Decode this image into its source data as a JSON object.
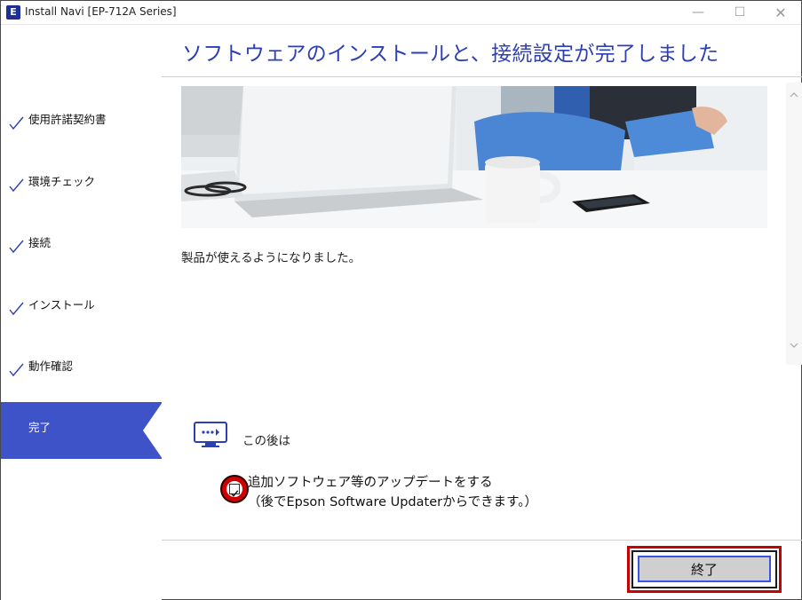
{
  "window": {
    "title": "Install Navi [EP-712A Series]",
    "app_icon": "E",
    "controls": {
      "minimize": "—",
      "maximize": "☐",
      "close": "✕"
    }
  },
  "sidebar": {
    "steps": [
      {
        "label": "使用許諾契約書",
        "state": "done"
      },
      {
        "label": "環境チェック",
        "state": "done"
      },
      {
        "label": "接続",
        "state": "done"
      },
      {
        "label": "インストール",
        "state": "done"
      },
      {
        "label": "動作確認",
        "state": "done"
      },
      {
        "label": "完了",
        "state": "active"
      }
    ]
  },
  "main": {
    "title": "ソフトウェアのインストールと、接続設定が完了しました",
    "message": "製品が使えるようになりました。",
    "after_label": "この後は",
    "update_option": {
      "label": "追加ソフトウェア等のアップデートをする",
      "note": "（後でEpson Software Updaterからできます。）",
      "checked": true
    },
    "finish_button": "終了"
  },
  "colors": {
    "accent": "#2c3fb3",
    "sidebar_active": "#3f53c8",
    "highlight": "#c80000"
  },
  "icons": [
    "check-icon",
    "monitor-next-icon",
    "scroll-up-icon",
    "scroll-down-icon"
  ]
}
